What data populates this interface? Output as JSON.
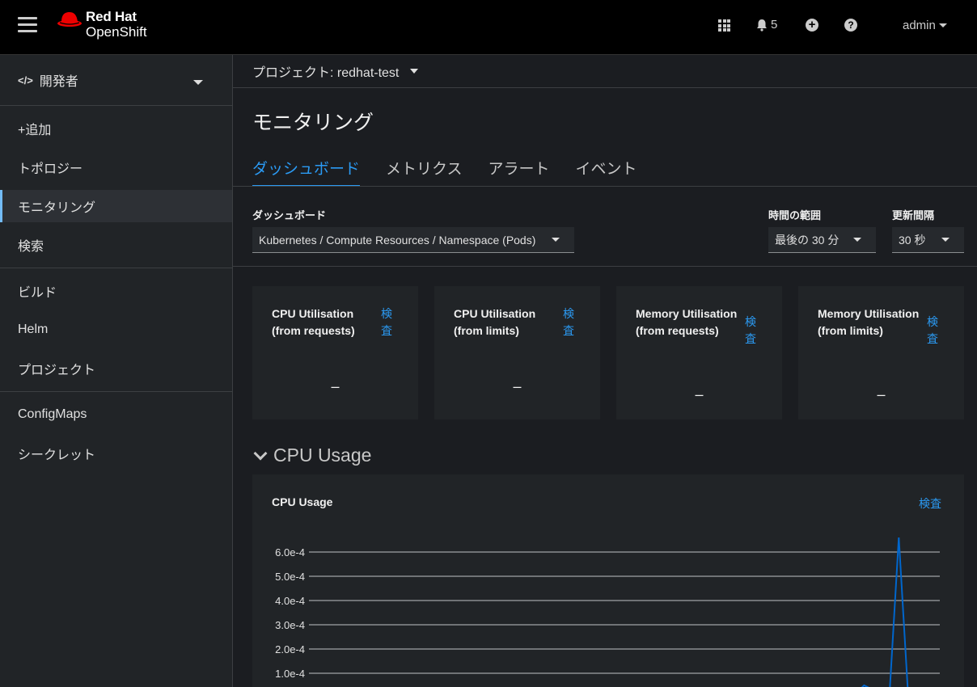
{
  "masthead": {
    "logo_line1": "Red Hat",
    "logo_line2": "OpenShift",
    "notification_count": "5",
    "user": "admin",
    "brand_color": "#ee0000"
  },
  "sidebar": {
    "perspective": "開発者",
    "groups": [
      [
        "+追加",
        "トポロジー",
        "モニタリング",
        "検索"
      ],
      [
        "ビルド",
        "Helm",
        "プロジェクト"
      ],
      [
        "ConfigMaps",
        "シークレット"
      ]
    ],
    "active_item": "モニタリング"
  },
  "project_bar": {
    "label": "プロジェクト: redhat-test"
  },
  "page": {
    "title": "モニタリング",
    "tabs": [
      "ダッシュボード",
      "メトリクス",
      "アラート",
      "イベント"
    ],
    "active_tab": "ダッシュボード"
  },
  "filters": {
    "dashboard_label": "ダッシュボード",
    "dashboard_value": "Kubernetes / Compute Resources / Namespace (Pods)",
    "time_range_label": "時間の範囲",
    "time_range_value": "最後の 30 分",
    "refresh_label": "更新間隔",
    "refresh_value": "30 秒"
  },
  "cards": [
    {
      "title": "CPU Utilisation (from requests)",
      "link": "検査",
      "value": "–"
    },
    {
      "title": "CPU Utilisation (from limits)",
      "link": "検査",
      "value": "–"
    },
    {
      "title": "Memory Utilisation (from requests)",
      "link": "検査",
      "value": "–"
    },
    {
      "title": "Memory Utilisation (from limits)",
      "link": "検査",
      "value": "–"
    }
  ],
  "section": {
    "title": "CPU Usage"
  },
  "chart": {
    "title": "CPU Usage",
    "link": "検査"
  },
  "chart_data": {
    "type": "line",
    "title": "CPU Usage",
    "ylim": [
      0,
      0.0006
    ],
    "yticks": [
      "6.0e-4",
      "5.0e-4",
      "4.0e-4",
      "3.0e-4",
      "2.0e-4",
      "1.0e-4"
    ],
    "ytick_values": [
      0.0006,
      0.0005,
      0.0004,
      0.0003,
      0.0002,
      0.0001
    ],
    "grid": true,
    "series": [
      {
        "color": "#06c",
        "x": [
          0.0,
          0.86,
          0.88,
          0.92,
          0.935,
          0.95
        ],
        "values": [
          0.0,
          0.0,
          5e-05,
          0.0,
          0.00066,
          0.0
        ]
      }
    ]
  }
}
